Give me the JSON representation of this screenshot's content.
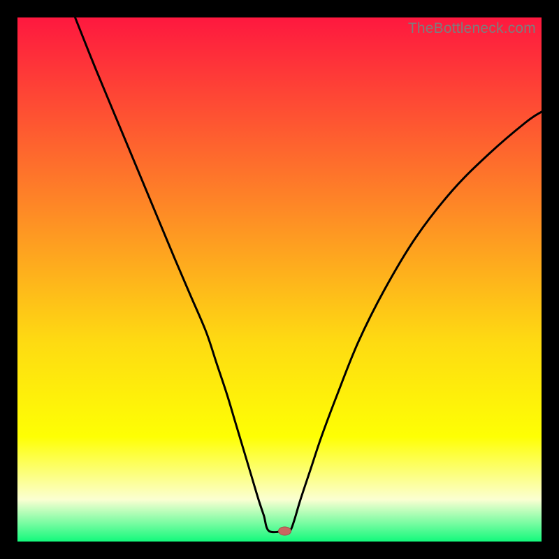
{
  "watermark": "TheBottleneck.com",
  "colors": {
    "gradient_top": "#fe183f",
    "gradient_mid_upper": "#fe8427",
    "gradient_mid": "#fedb12",
    "gradient_mid_lower": "#feff04",
    "gradient_pale": "#fbffd2",
    "gradient_bottom": "#13f97c",
    "curve": "#000000",
    "marker_fill": "#c86660",
    "marker_stroke": "#a04e48"
  },
  "chart_data": {
    "type": "line",
    "title": "",
    "xlabel": "",
    "ylabel": "",
    "xlim": [
      0,
      100
    ],
    "ylim": [
      0,
      100
    ],
    "series": [
      {
        "name": "bottleneck-curve",
        "x": [
          11,
          15,
          20,
          25,
          30,
          33,
          36,
          38,
          40,
          41.5,
          43,
          44.5,
          46,
          47,
          48,
          51,
          52,
          52.8,
          54,
          56,
          58,
          61,
          65,
          70,
          76,
          83,
          90,
          97,
          100
        ],
        "y": [
          100,
          90,
          78,
          66,
          54,
          47,
          40,
          34,
          28,
          23,
          18,
          13,
          8,
          5,
          2,
          2,
          2,
          4,
          8,
          14,
          20,
          28,
          38,
          48,
          58,
          67,
          74,
          80,
          82
        ]
      }
    ],
    "marker": {
      "x": 51,
      "y": 2
    }
  }
}
